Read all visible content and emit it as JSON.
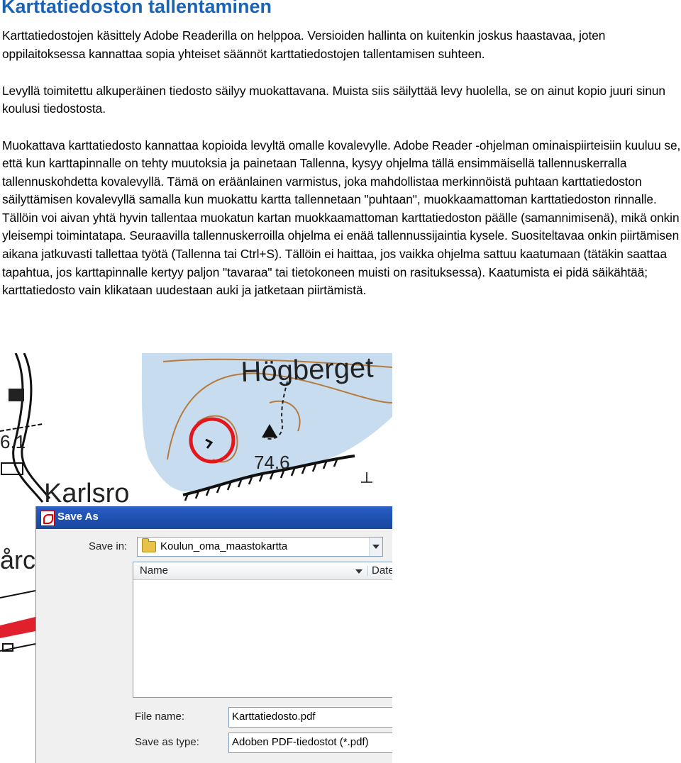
{
  "page": {
    "title": "Karttatiedoston tallentaminen",
    "paragraphs": [
      "Karttatiedostojen käsittely Adobe Readerilla on helppoa. Versioiden hallinta on kuitenkin joskus haastavaa, joten oppilaitoksessa kannattaa sopia yhteiset säännöt karttatiedostojen tallentamisen suhteen.",
      "Levyllä toimitettu alkuperäinen tiedosto säilyy muokattavana. Muista siis säilyttää levy huolella, se on ainut kopio juuri sinun koulusi tiedostosta.",
      "Muokattava karttatiedosto kannattaa kopioida levyltä omalle kovalevylle. Adobe Reader -ohjelman ominaispiirteisiin kuuluu se, että kun karttapinnalle on tehty muutoksia ja painetaan Tallenna, kysyy ohjelma tällä ensimmäisellä tallennuskerralla tallennuskohdetta kovalevyllä. Tämä on eräänlainen varmistus, joka mahdollistaa merkinnöistä puhtaan karttatiedoston säilyttämisen kovalevyllä samalla kun muokattu kartta tallennetaan \"puhtaan\", muokkaamattoman karttatiedoston rinnalle. Tällöin voi aivan yhtä hyvin tallentaa muokatun kartan muokkaamattoman karttatiedoston päälle (samannimisenä), mikä onkin yleisempi toimintatapa. Seuraavilla tallennuskerroilla ohjelma ei enää tallennussijaintia kysele. Suositeltavaa onkin piirtämisen aikana jatkuvasti tallettaa työtä (Tallenna tai Ctrl+S). Tällöin ei haittaa, jos vaikka ohjelma sattuu kaatumaan (tätäkin saattaa tapahtua, jos karttapinnalle kertyy paljon \"tavaraa\" tai tietokoneen muisti on rasituksessa). Kaatumista ei pidä säikähtää; karttatiedosto vain klikataan uudestaan auki ja jatketaan piirtämistä."
    ]
  },
  "map": {
    "labels": {
      "place_hogberget": "Högberget",
      "place_karlsro": "Karlsro",
      "place_partial": "årc",
      "elevation": "74.6",
      "grid_number": "6.1"
    },
    "colors": {
      "water": "#c7dcee",
      "land": "#ffffff",
      "contour": "#b57b3e",
      "marker_circle": "#e4161b",
      "road_red": "#e0212d"
    }
  },
  "dialog": {
    "title": "Save As",
    "save_in_label": "Save in:",
    "save_in_value": "Koulun_oma_maastokartta",
    "columns": {
      "name": "Name",
      "date": "Date"
    },
    "file_name_label": "File name:",
    "file_name_value": "Karttatiedosto.pdf",
    "save_type_label": "Save as type:",
    "save_type_value": "Adoben PDF-tiedostot (*.pdf)"
  }
}
